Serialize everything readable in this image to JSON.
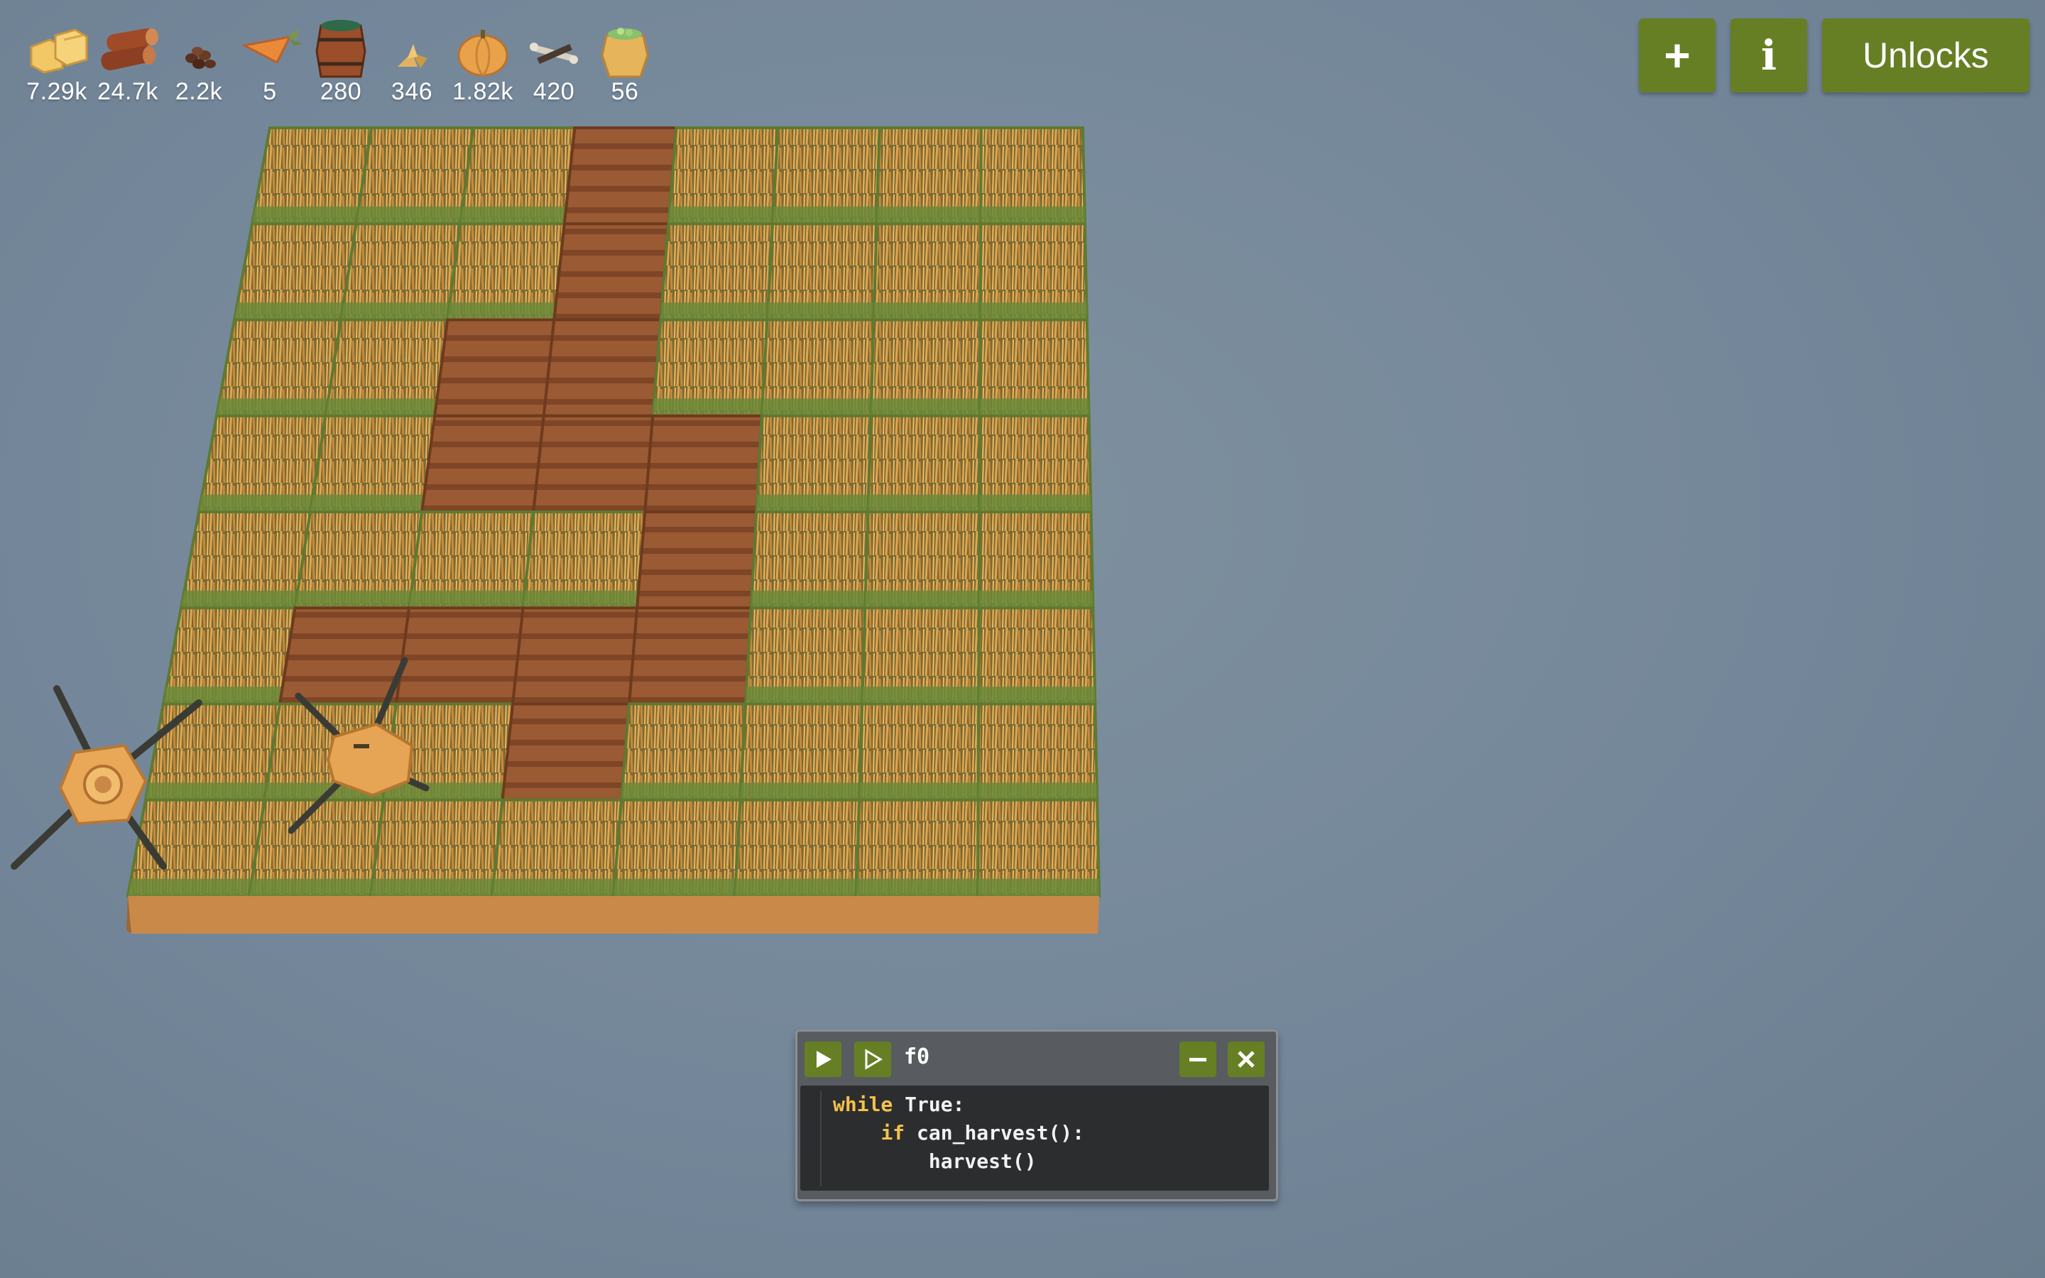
{
  "resources": [
    {
      "icon": "hay-icon",
      "count": "7.29k"
    },
    {
      "icon": "wood-log-icon",
      "count": "24.7k"
    },
    {
      "icon": "seeds-icon",
      "count": "2.2k"
    },
    {
      "icon": "carrot-icon",
      "count": "5"
    },
    {
      "icon": "water-barrel-icon",
      "count": "280"
    },
    {
      "icon": "sprout-icon",
      "count": "346"
    },
    {
      "icon": "pumpkin-icon",
      "count": "1.82k"
    },
    {
      "icon": "bones-icon",
      "count": "420"
    },
    {
      "icon": "gold-pot-icon",
      "count": "56"
    }
  ],
  "toolbar": {
    "add_icon": "plus-icon",
    "info_icon": "info-icon",
    "unlocks_label": "Unlocks"
  },
  "code_window": {
    "title": "f0",
    "code_lines": [
      {
        "indent": "",
        "keyword": "while",
        "rest": " True:"
      },
      {
        "indent": "    ",
        "keyword": "if",
        "rest": " can_harvest():"
      },
      {
        "indent": "        ",
        "keyword": "",
        "rest": "harvest()"
      }
    ]
  },
  "colors": {
    "button_green": "#667f24",
    "background": "#74879a",
    "keyword": "#f3c24a",
    "soil": "#9a5a33",
    "grass": "#6a8a3a",
    "wheat": "#d49b45"
  }
}
